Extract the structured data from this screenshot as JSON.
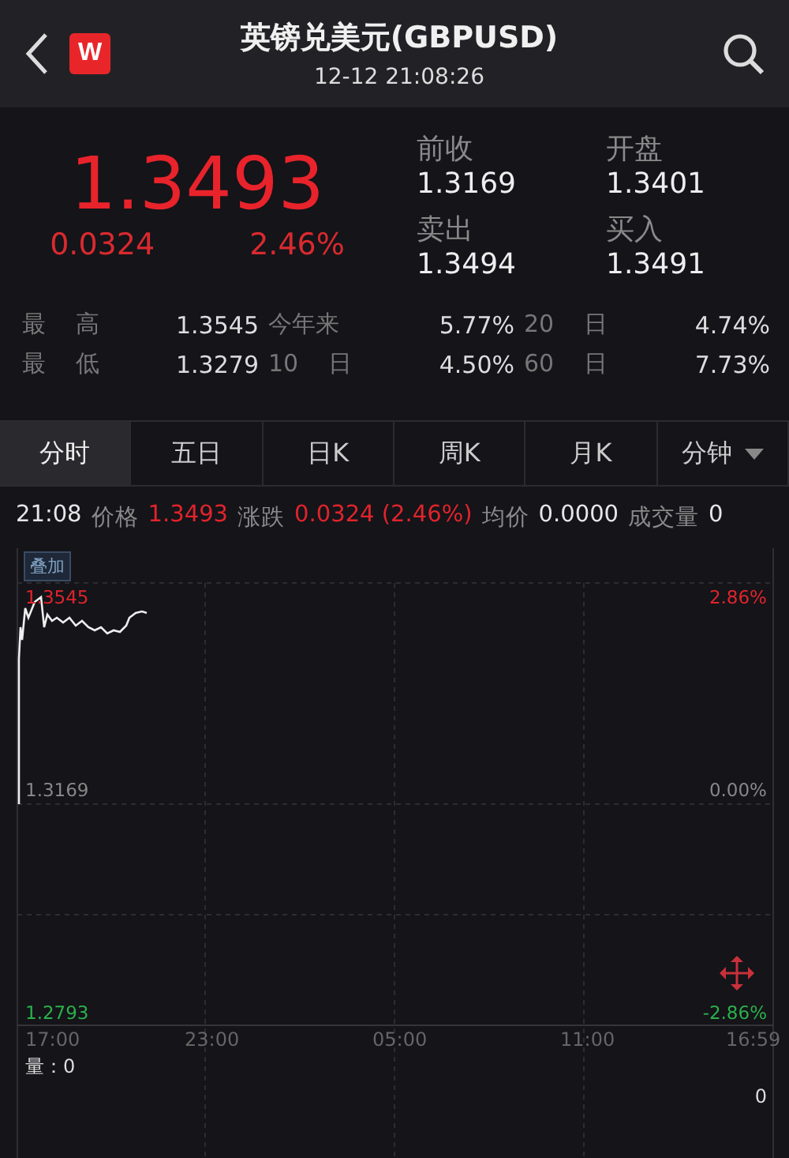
{
  "header": {
    "title": "英镑兑美元(GBPUSD)",
    "time": "12-12 21:08:26",
    "badge": "W"
  },
  "quote": {
    "price": "1.3493",
    "change": "0.0324",
    "percent": "2.46%",
    "fields": [
      {
        "label": "前收",
        "value": "1.3169"
      },
      {
        "label": "开盘",
        "value": "1.3401"
      },
      {
        "label": "卖出",
        "value": "1.3494"
      },
      {
        "label": "买入",
        "value": "1.3491"
      }
    ]
  },
  "stats": [
    [
      {
        "label": "最 高",
        "value": "1.3545"
      },
      {
        "label": "今年来",
        "value": "5.77%"
      },
      {
        "label": "20 日",
        "value": "4.74%"
      }
    ],
    [
      {
        "label": "最 低",
        "value": "1.3279"
      },
      {
        "label": "10 日",
        "value": "4.50%"
      },
      {
        "label": "60 日",
        "value": "7.73%"
      }
    ]
  ],
  "tabs": [
    {
      "label": "分时",
      "selected": true
    },
    {
      "label": "五日",
      "selected": false
    },
    {
      "label": "日K",
      "selected": false
    },
    {
      "label": "周K",
      "selected": false
    },
    {
      "label": "月K",
      "selected": false
    },
    {
      "label": "分钟",
      "selected": false,
      "kind": "dropdown"
    }
  ],
  "info": [
    {
      "label": "21:08",
      "kind": "time"
    },
    {
      "label": "价格",
      "kind": "label"
    },
    {
      "label": "1.3493",
      "kind": "up"
    },
    {
      "label": "涨跌",
      "kind": "label"
    },
    {
      "label": "0.0324 (2.46%)",
      "kind": "up"
    },
    {
      "label": "均价",
      "kind": "label"
    },
    {
      "label": "0.0000",
      "kind": "value"
    },
    {
      "label": "成交量",
      "kind": "label"
    },
    {
      "label": "0",
      "kind": "value"
    }
  ],
  "chart": {
    "overlay_button": "叠加",
    "price_labels": [
      {
        "price": "1.3545",
        "percent": "2.86%",
        "kind": "up"
      },
      {
        "price": "1.3169",
        "percent": "0.00%",
        "kind": "flat"
      },
      {
        "price": "1.2793",
        "percent": "-2.86%",
        "kind": "down"
      }
    ],
    "time_labels": [
      "17:00",
      "23:00",
      "05:00",
      "11:00",
      "16:59"
    ],
    "volume_label": "量：0",
    "volume_max": "0"
  }
}
